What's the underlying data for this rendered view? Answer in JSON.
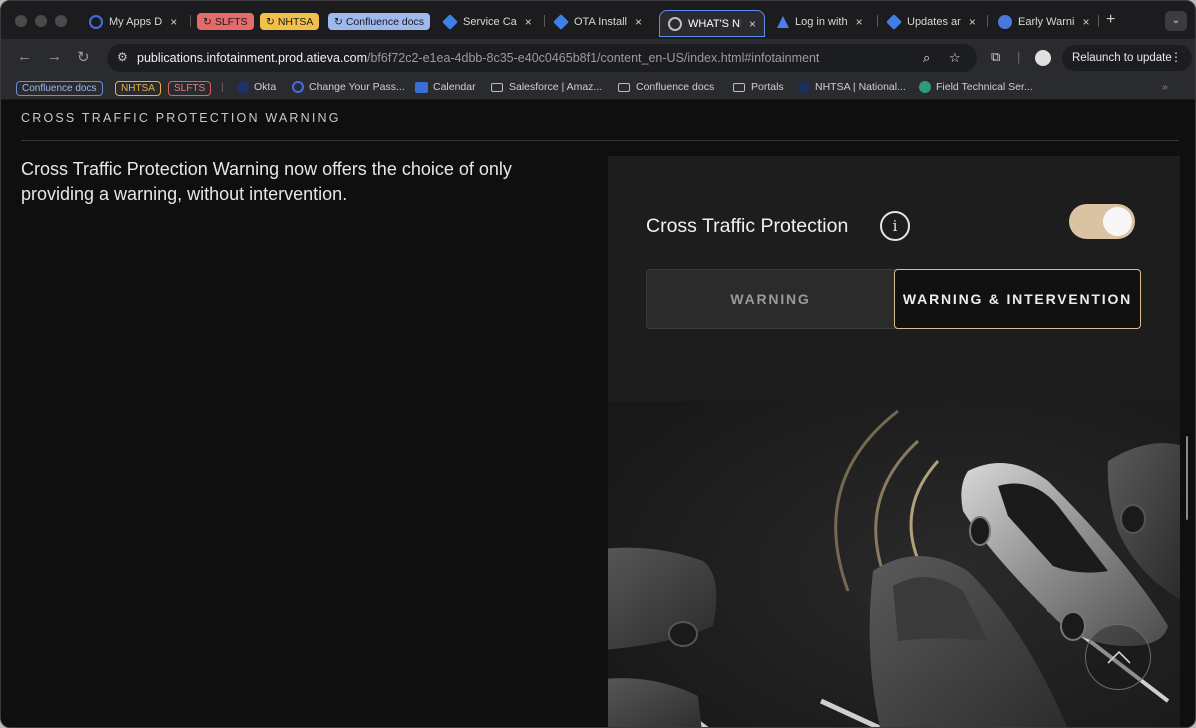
{
  "browser": {
    "tabs": [
      {
        "label": "My Apps D",
        "close": "×",
        "icon_color": "#3f6fe0"
      },
      {
        "label": "Service Ca",
        "close": "×",
        "icon_color": "#3f7fe8"
      },
      {
        "label": "OTA Install",
        "close": "×",
        "icon_color": "#3f7fe8"
      },
      {
        "label": "WHAT'S NE",
        "close": "×",
        "icon_color": "#8c8c8c"
      },
      {
        "label": "Log in with",
        "close": "×",
        "icon_color": "#4a7df0"
      },
      {
        "label": "Updates ar",
        "close": "×",
        "icon_color": "#3f7fe8"
      },
      {
        "label": "Early Warni",
        "close": "×",
        "icon_color": "#4a78d8"
      }
    ],
    "tab_groups": [
      {
        "label": "SLFTS",
        "bg": "#e46b6b",
        "fg": "#1a1a1a"
      },
      {
        "label": "NHTSA",
        "bg": "#f0c04a",
        "fg": "#1a1a1a"
      },
      {
        "label": "Confluence docs",
        "bg": "#9fb8ee",
        "fg": "#1a1a1a"
      }
    ],
    "new_tab": "+",
    "tab_menu": "⌄",
    "url_host": "publications.infotainment.prod.atieva.com",
    "url_path": "/bf6f72c2-e1ea-4dbb-8c35-e40c0465b8f1/content_en-US/index.html#infotainment",
    "relaunch_label": "Relaunch to update",
    "relaunch_menu": "⋮",
    "bookmark_groups": [
      {
        "label": "Confluence docs",
        "border": "#6a8fd8",
        "fg": "#9fb8ee"
      },
      {
        "label": "NHTSA",
        "border": "#e0b24a",
        "fg": "#e0b24a"
      },
      {
        "label": "SLFTS",
        "border": "#e06060",
        "fg": "#e08080"
      }
    ],
    "bookmarks": [
      "Okta",
      "Change Your Pass...",
      "Calendar",
      "Salesforce | Amaz...",
      "Confluence docs",
      "Portals",
      "NHTSA | National...",
      "Field Technical Ser..."
    ],
    "bookmarks_more": "»"
  },
  "page": {
    "section_title": "CROSS TRAFFIC PROTECTION WARNING",
    "description": "Cross Traffic Protection Warning now offers the choice of only providing a warning, without intervention.",
    "setting_label": "Cross Traffic Protection",
    "info_symbol": "i",
    "toggle_on": true,
    "options": [
      "WARNING",
      "WARNING & INTERVENTION"
    ],
    "selected_option": "WARNING & INTERVENTION"
  },
  "colors": {
    "toggle_on": "#d9c3a3",
    "accent_border": "#d7bd93",
    "active_tab_outline": "#5b8ee6"
  }
}
